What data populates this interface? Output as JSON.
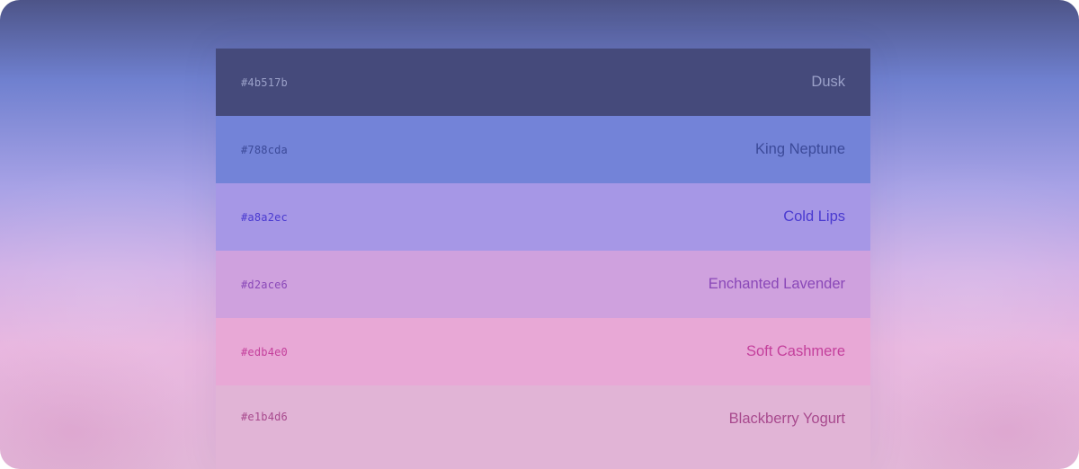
{
  "palette": {
    "swatches": [
      {
        "hex": "#4b517b",
        "name": "Dusk",
        "bg": "#454a7b",
        "text_color": "#9aa0c8"
      },
      {
        "hex": "#788cda",
        "name": "King Neptune",
        "bg": "#7383d8",
        "text_color": "#3c4a99"
      },
      {
        "hex": "#a8a2ec",
        "name": "Cold Lips",
        "bg": "#a697e6",
        "text_color": "#4a3ad0"
      },
      {
        "hex": "#d2ace6",
        "name": "Enchanted Lavender",
        "bg": "#cfa1de",
        "text_color": "#8a48b8"
      },
      {
        "hex": "#edb4e0",
        "name": "Soft Cashmere",
        "bg": "#e8a8d6",
        "text_color": "#c4409c"
      },
      {
        "hex": "#e1b4d6",
        "name": "Blackberry Yogurt",
        "bg": "#e1b4d6",
        "text_color": "#a84a8e"
      }
    ]
  }
}
